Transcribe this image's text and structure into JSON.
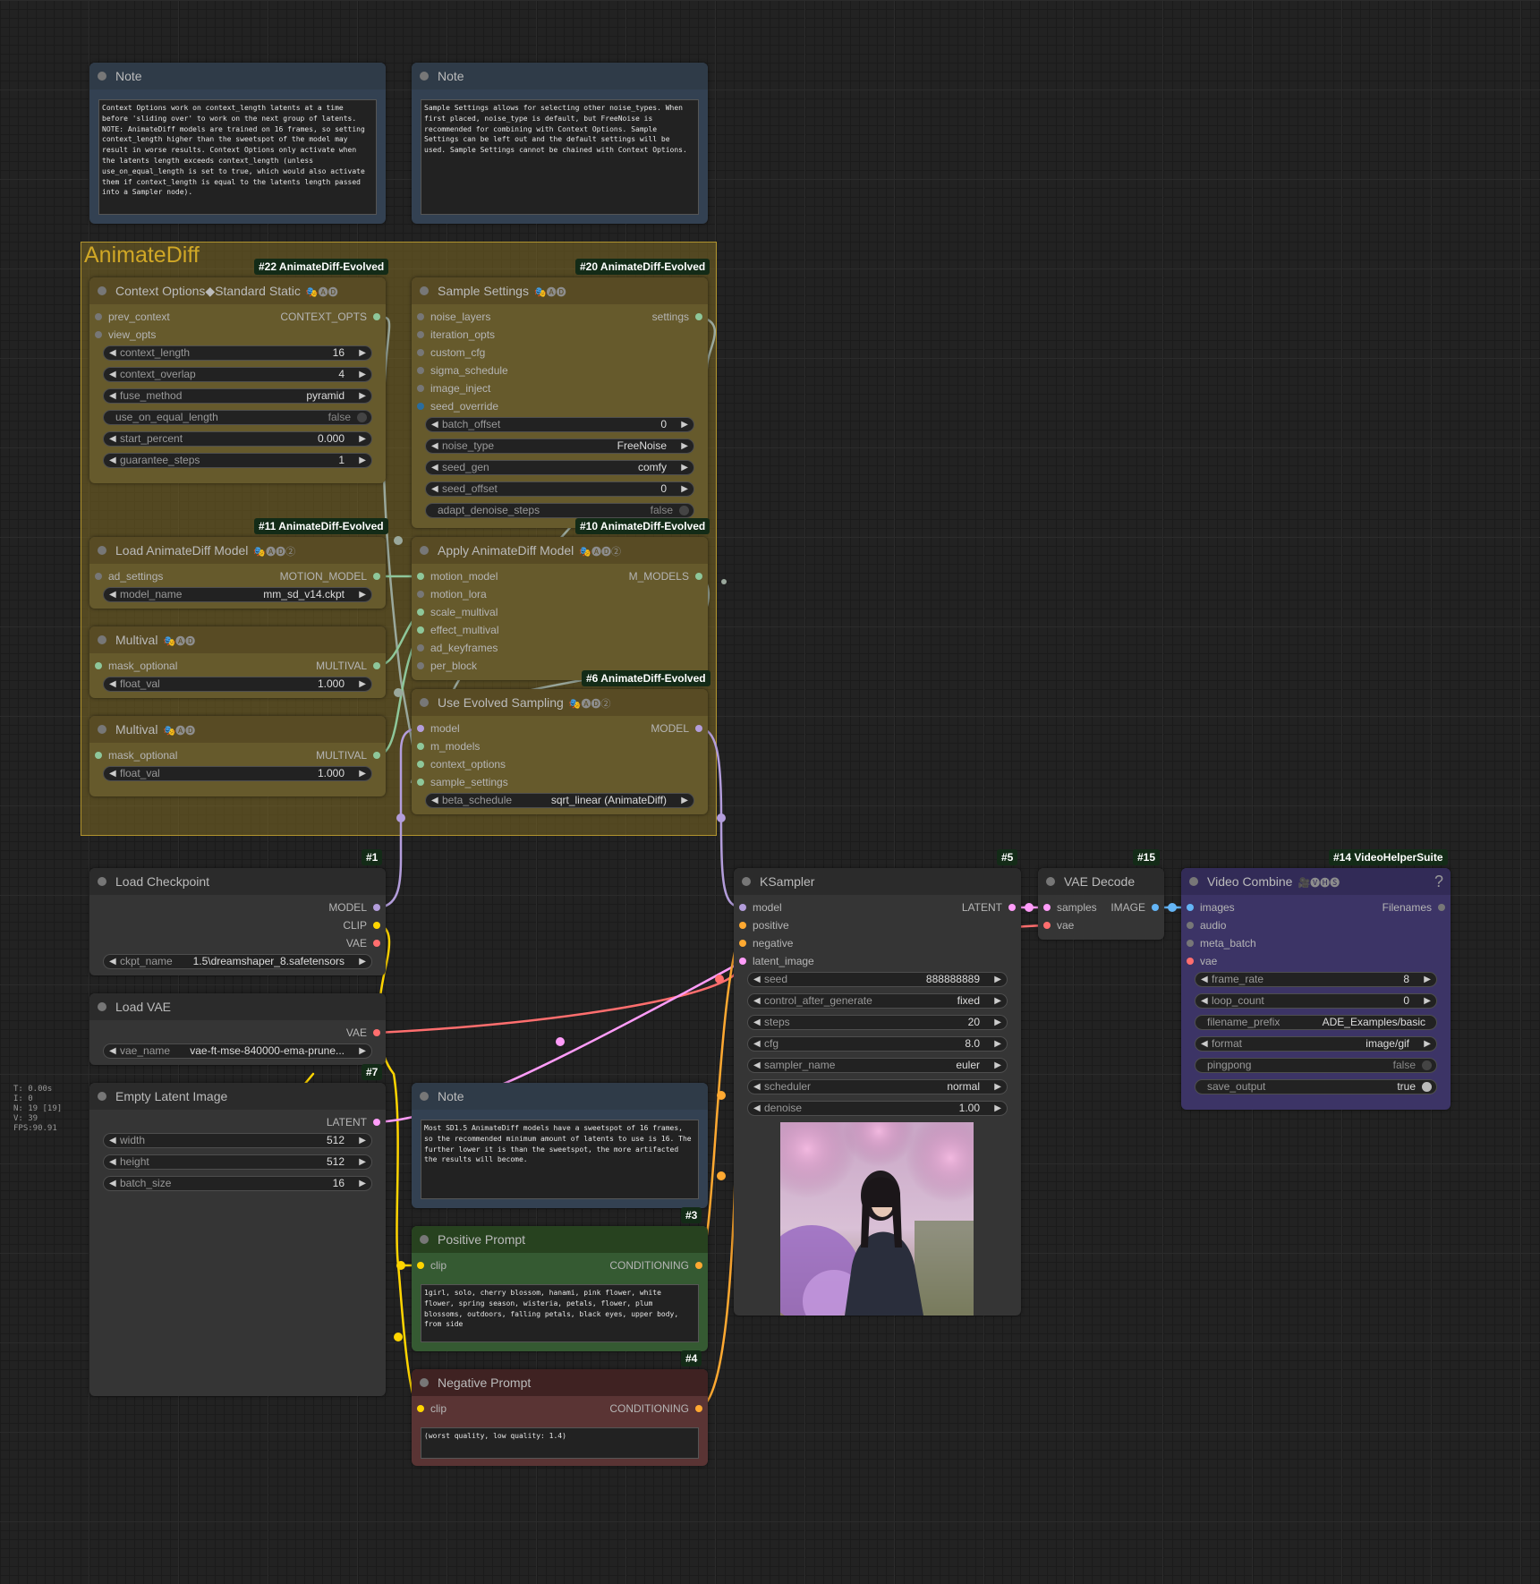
{
  "colors": {
    "model": "#b39ddb",
    "clip": "#ffd500",
    "vae": "#ff6e6e",
    "latent": "#ff9cf9",
    "conditioning": "#ffa931",
    "image": "#64b5f6",
    "motion": "#8ec79a",
    "generic": "#9aa89c"
  },
  "group": {
    "title": "AnimateDiff"
  },
  "badges": {
    "b22": "#22 AnimateDiff-Evolved",
    "b20": "#20 AnimateDiff-Evolved",
    "b11": "#11 AnimateDiff-Evolved",
    "b10": "#10 AnimateDiff-Evolved",
    "b6": "#6 AnimateDiff-Evolved",
    "b1": "#1",
    "b5": "#5",
    "b15": "#15",
    "b14": "#14 VideoHelperSuite",
    "b7": "#7",
    "b3": "#3",
    "b4": "#4"
  },
  "note1": {
    "title": "Note",
    "text": "Context Options work on context_length latents at a time before 'sliding over' to work on the next group of latents. NOTE: AnimateDiff models are trained on 16 frames, so setting context_length higher than the sweetspot of the model may result in worse results. Context Options only activate when the latents length exceeds context_length (unless use_on_equal_length is set to true, which would also activate them if context_length is equal to the latents length passed into a Sampler node)."
  },
  "note2": {
    "title": "Note",
    "text": "Sample Settings allows for selecting other noise_types. When first placed, noise_type is default, but FreeNoise is recommended for combining with Context Options. Sample Settings can be left out and the default settings will be used. Sample Settings cannot be chained with Context Options."
  },
  "note3": {
    "title": "Note",
    "text": "Most SD1.5 AnimateDiff models have a sweetspot of 16 frames, so the recommended minimum amount of latents to use is 16. The further lower it is than the sweetspot, the more artifacted the results will become."
  },
  "context_options": {
    "title": "Context Options◆Standard Static",
    "extra": "🎭🅐🅓",
    "inputs": [
      "prev_context",
      "view_opts"
    ],
    "output": "CONTEXT_OPTS",
    "widgets": [
      {
        "label": "context_length",
        "value": "16"
      },
      {
        "label": "context_overlap",
        "value": "4"
      },
      {
        "label": "fuse_method",
        "value": "pyramid"
      },
      {
        "label": "use_on_equal_length",
        "value": "false"
      },
      {
        "label": "start_percent",
        "value": "0.000"
      },
      {
        "label": "guarantee_steps",
        "value": "1"
      }
    ]
  },
  "sample_settings": {
    "title": "Sample Settings",
    "extra": "🎭🅐🅓",
    "inputs": [
      "noise_layers",
      "iteration_opts",
      "custom_cfg",
      "sigma_schedule",
      "image_inject",
      "seed_override"
    ],
    "output": "settings",
    "widgets": [
      {
        "label": "batch_offset",
        "value": "0"
      },
      {
        "label": "noise_type",
        "value": "FreeNoise"
      },
      {
        "label": "seed_gen",
        "value": "comfy"
      },
      {
        "label": "seed_offset",
        "value": "0"
      },
      {
        "label": "adapt_denoise_steps",
        "value": "false"
      }
    ]
  },
  "load_ad_model": {
    "title": "Load AnimateDiff Model",
    "extra": "🎭🅐🅓②",
    "input": "ad_settings",
    "output": "MOTION_MODEL",
    "widget": {
      "label": "model_name",
      "value": "mm_sd_v14.ckpt"
    }
  },
  "apply_ad_model": {
    "title": "Apply AnimateDiff Model",
    "extra": "🎭🅐🅓②",
    "inputs": [
      "motion_model",
      "motion_lora",
      "scale_multival",
      "effect_multival",
      "ad_keyframes",
      "per_block"
    ],
    "output": "M_MODELS"
  },
  "multival1": {
    "title": "Multival",
    "extra": "🎭🅐🅓",
    "input": "mask_optional",
    "output": "MULTIVAL",
    "widget": {
      "label": "float_val",
      "value": "1.000"
    }
  },
  "multival2": {
    "title": "Multival",
    "extra": "🎭🅐🅓",
    "input": "mask_optional",
    "output": "MULTIVAL",
    "widget": {
      "label": "float_val",
      "value": "1.000"
    }
  },
  "use_evolved": {
    "title": "Use Evolved Sampling",
    "extra": "🎭🅐🅓②",
    "inputs": [
      "model",
      "m_models",
      "context_options",
      "sample_settings"
    ],
    "output": "MODEL",
    "widget": {
      "label": "beta_schedule",
      "value": "sqrt_linear (AnimateDiff)"
    }
  },
  "load_checkpoint": {
    "title": "Load Checkpoint",
    "outputs": [
      "MODEL",
      "CLIP",
      "VAE"
    ],
    "widget": {
      "label": "ckpt_name",
      "value": "1.5\\dreamshaper_8.safetensors"
    }
  },
  "load_vae": {
    "title": "Load VAE",
    "output": "VAE",
    "widget": {
      "label": "vae_name",
      "value": "vae-ft-mse-840000-ema-prune..."
    }
  },
  "empty_latent": {
    "title": "Empty Latent Image",
    "output": "LATENT",
    "widgets": [
      {
        "label": "width",
        "value": "512"
      },
      {
        "label": "height",
        "value": "512"
      },
      {
        "label": "batch_size",
        "value": "16"
      }
    ]
  },
  "positive": {
    "title": "Positive Prompt",
    "input": "clip",
    "output": "CONDITIONING",
    "text": "1girl, solo, cherry blossom, hanami, pink flower, white flower, spring season, wisteria, petals, flower, plum blossoms, outdoors, falling petals, black eyes, upper body, from side"
  },
  "negative": {
    "title": "Negative Prompt",
    "input": "clip",
    "output": "CONDITIONING",
    "text": "(worst quality, low quality: 1.4)"
  },
  "ksampler": {
    "title": "KSampler",
    "inputs": [
      "model",
      "positive",
      "negative",
      "latent_image"
    ],
    "output": "LATENT",
    "widgets": [
      {
        "label": "seed",
        "value": "888888889"
      },
      {
        "label": "control_after_generate",
        "value": "fixed"
      },
      {
        "label": "steps",
        "value": "20"
      },
      {
        "label": "cfg",
        "value": "8.0"
      },
      {
        "label": "sampler_name",
        "value": "euler"
      },
      {
        "label": "scheduler",
        "value": "normal"
      },
      {
        "label": "denoise",
        "value": "1.00"
      }
    ]
  },
  "vae_decode": {
    "title": "VAE Decode",
    "inputs": [
      "samples",
      "vae"
    ],
    "output": "IMAGE"
  },
  "video_combine": {
    "title": "Video Combine",
    "extra": "🎥🅥🅗🅢",
    "help": "?",
    "inputs": [
      "images",
      "audio",
      "meta_batch",
      "vae"
    ],
    "output": "Filenames",
    "widgets": [
      {
        "label": "frame_rate",
        "value": "8"
      },
      {
        "label": "loop_count",
        "value": "0"
      },
      {
        "label": "filename_prefix",
        "value": "ADE_Examples/basic"
      },
      {
        "label": "format",
        "value": "image/gif"
      },
      {
        "label": "pingpong",
        "value": "false"
      },
      {
        "label": "save_output",
        "value": "true"
      }
    ]
  },
  "stats": [
    "T: 0.00s",
    "I: 0",
    "N: 19 [19]",
    "V: 39",
    "FPS:90.91"
  ]
}
